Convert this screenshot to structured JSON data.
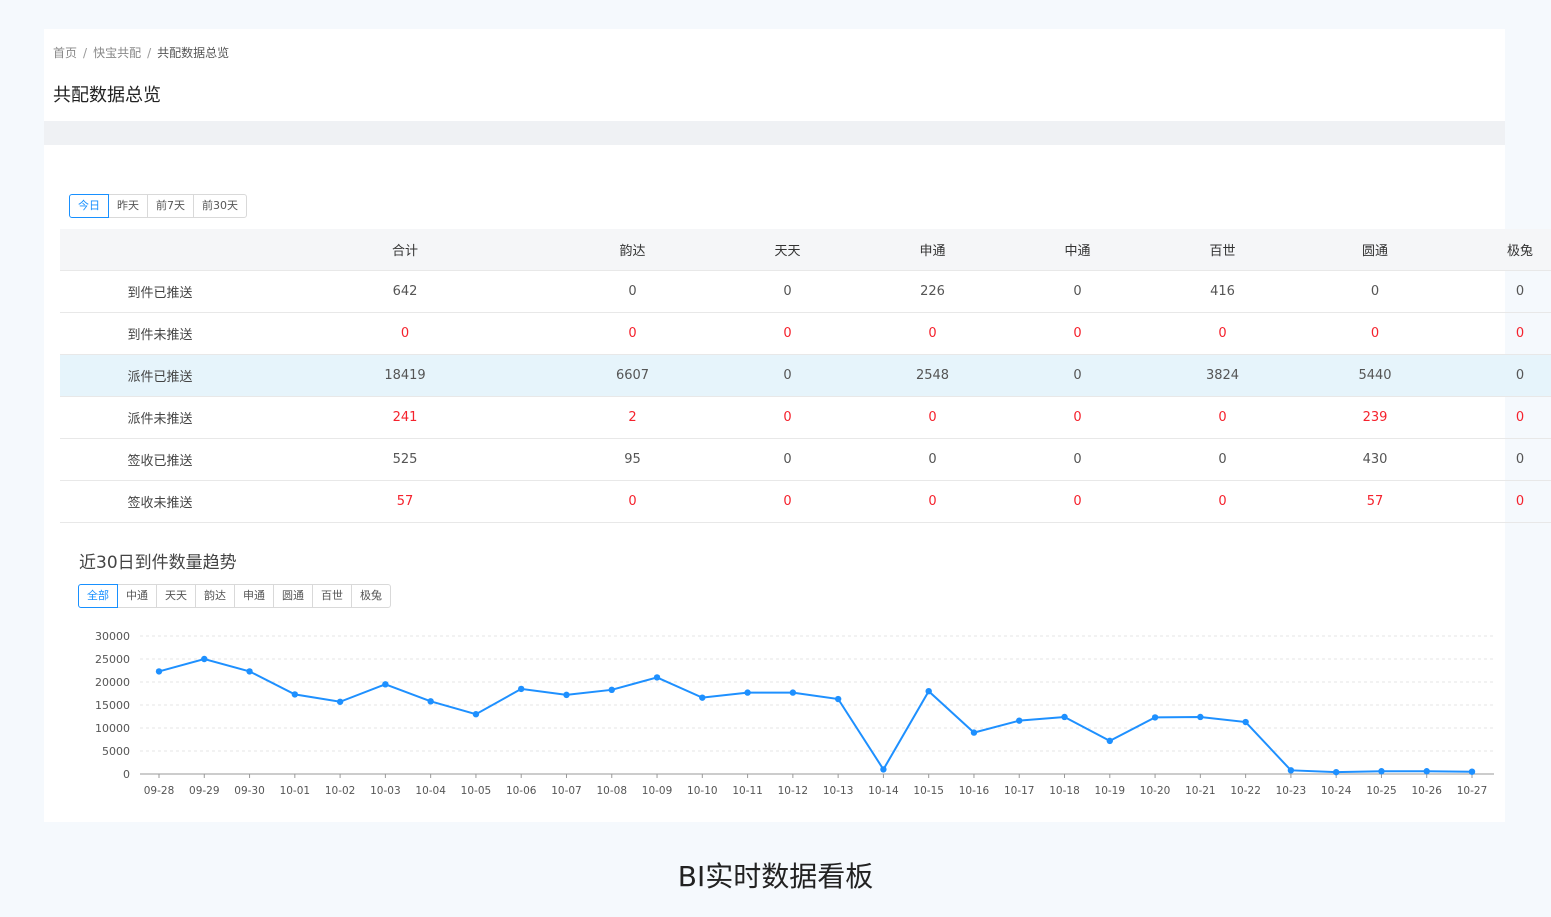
{
  "breadcrumb": {
    "home": "首页",
    "section": "快宝共配",
    "current": "共配数据总览"
  },
  "page_title": "共配数据总览",
  "date_tabs": [
    {
      "label": "今日",
      "active": true
    },
    {
      "label": "昨天",
      "active": false
    },
    {
      "label": "前7天",
      "active": false
    },
    {
      "label": "前30天",
      "active": false
    }
  ],
  "table": {
    "columns": [
      "",
      "合计",
      "韵达",
      "天天",
      "申通",
      "中通",
      "百世",
      "圆通",
      "极兔"
    ],
    "rows": [
      {
        "label": "到件已推送",
        "values": [
          "642",
          "0",
          "0",
          "226",
          "0",
          "416",
          "0",
          "0"
        ],
        "alert": false,
        "highlight": false
      },
      {
        "label": "到件未推送",
        "values": [
          "0",
          "0",
          "0",
          "0",
          "0",
          "0",
          "0",
          "0"
        ],
        "alert": true,
        "highlight": false
      },
      {
        "label": "派件已推送",
        "values": [
          "18419",
          "6607",
          "0",
          "2548",
          "0",
          "3824",
          "5440",
          "0"
        ],
        "alert": false,
        "highlight": true
      },
      {
        "label": "派件未推送",
        "values": [
          "241",
          "2",
          "0",
          "0",
          "0",
          "0",
          "239",
          "0"
        ],
        "alert": true,
        "highlight": false
      },
      {
        "label": "签收已推送",
        "values": [
          "525",
          "95",
          "0",
          "0",
          "0",
          "0",
          "430",
          "0"
        ],
        "alert": false,
        "highlight": false
      },
      {
        "label": "签收未推送",
        "values": [
          "57",
          "0",
          "0",
          "0",
          "0",
          "0",
          "57",
          "0"
        ],
        "alert": true,
        "highlight": false
      }
    ]
  },
  "chart_title": "近30日到件数量趋势",
  "carrier_tabs": [
    {
      "label": "全部",
      "active": true
    },
    {
      "label": "中通",
      "active": false
    },
    {
      "label": "天天",
      "active": false
    },
    {
      "label": "韵达",
      "active": false
    },
    {
      "label": "申通",
      "active": false
    },
    {
      "label": "圆通",
      "active": false
    },
    {
      "label": "百世",
      "active": false
    },
    {
      "label": "极兔",
      "active": false
    }
  ],
  "colors": {
    "accent": "#1890ff",
    "alert": "#f5222d",
    "line": "#1e90ff",
    "highlight_row": "#e6f4fb"
  },
  "chart_data": {
    "type": "line",
    "title": "",
    "xlabel": "",
    "ylabel": "",
    "ylim": [
      0,
      30000
    ],
    "yticks": [
      0,
      5000,
      10000,
      15000,
      20000,
      25000,
      30000
    ],
    "grid": true,
    "x": [
      "09-28",
      "09-29",
      "09-30",
      "10-01",
      "10-02",
      "10-03",
      "10-04",
      "10-05",
      "10-06",
      "10-07",
      "10-08",
      "10-09",
      "10-10",
      "10-11",
      "10-12",
      "10-13",
      "10-14",
      "10-15",
      "10-16",
      "10-17",
      "10-18",
      "10-19",
      "10-20",
      "10-21",
      "10-22",
      "10-23",
      "10-24",
      "10-25",
      "10-26",
      "10-27"
    ],
    "series": [
      {
        "values": [
          22300,
          25000,
          22300,
          17300,
          15700,
          19500,
          15800,
          13000,
          18500,
          17200,
          18300,
          21000,
          16600,
          17700,
          17700,
          16300,
          1000,
          18000,
          9000,
          11600,
          12400,
          7200,
          12300,
          12400,
          11300,
          800,
          400,
          600,
          600,
          500
        ]
      }
    ]
  },
  "caption": "BI实时数据看板"
}
